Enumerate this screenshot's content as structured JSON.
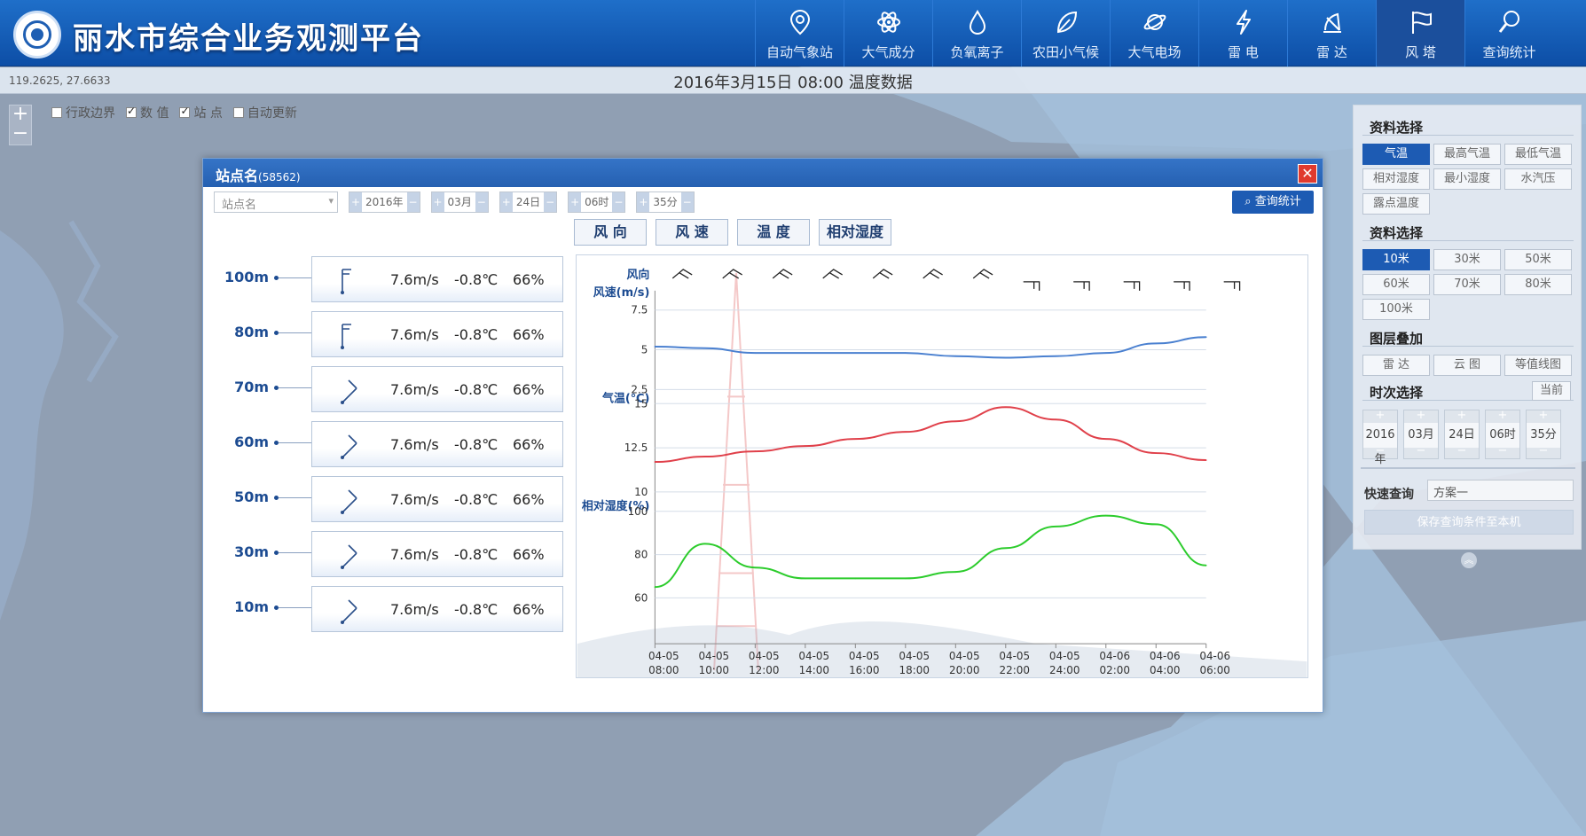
{
  "app": {
    "title": "丽水市综合业务观测平台"
  },
  "nav": [
    {
      "label": "自动气象站",
      "icon": "map-pin-icon"
    },
    {
      "label": "大气成分",
      "icon": "atom-icon"
    },
    {
      "label": "负氧离子",
      "icon": "droplet-icon"
    },
    {
      "label": "农田小气候",
      "icon": "leaf-icon"
    },
    {
      "label": "大气电场",
      "icon": "planet-icon"
    },
    {
      "label": "雷 电",
      "icon": "lightning-icon"
    },
    {
      "label": "雷 达",
      "icon": "radar-icon"
    },
    {
      "label": "风 塔",
      "icon": "wind-tower-icon",
      "active": true
    },
    {
      "label": "查询统计",
      "icon": "search-icon"
    }
  ],
  "subbar": {
    "coords": "119.2625, 27.6633",
    "title": "2016年3月15日 08:00 温度数据"
  },
  "layers": [
    {
      "label": "行政边界",
      "checked": false
    },
    {
      "label": "数 值",
      "checked": true
    },
    {
      "label": "站 点",
      "checked": true
    },
    {
      "label": "自动更新",
      "checked": false
    }
  ],
  "panel": {
    "data_title": "资料选择",
    "data_buttons": [
      "气温",
      "最高气温",
      "最低气温",
      "相对湿度",
      "最小湿度",
      "水汽压",
      "露点温度"
    ],
    "height_title": "资料选择",
    "height_buttons": [
      "10米",
      "30米",
      "50米",
      "60米",
      "70米",
      "80米",
      "100米"
    ],
    "overlay_title": "图层叠加",
    "overlay_buttons": [
      "雷 达",
      "云 图",
      "等值线图"
    ],
    "time_title": "时次选择",
    "time_now": "当前",
    "time_steps": [
      "2016年",
      "03月",
      "24日",
      "06时",
      "35分"
    ],
    "quick_label": "快速查询",
    "quick_value": "方案一",
    "save_label": "保存查询条件至本机"
  },
  "modal": {
    "title": "站点名",
    "station_id": "(58562)",
    "station_placeholder": "站点名",
    "steps": [
      "2016年",
      "03月",
      "24日",
      "06时",
      "35分"
    ],
    "query_label": "查询统计",
    "tabs": [
      "风 向",
      "风 速",
      "温 度",
      "相对湿度"
    ],
    "heights": [
      {
        "h": "100m",
        "speed": "7.6m/s",
        "temp": "-0.8℃",
        "hum": "66%",
        "barb": "flag"
      },
      {
        "h": "80m",
        "speed": "7.6m/s",
        "temp": "-0.8℃",
        "hum": "66%",
        "barb": "flag"
      },
      {
        "h": "70m",
        "speed": "7.6m/s",
        "temp": "-0.8℃",
        "hum": "66%",
        "barb": "diag"
      },
      {
        "h": "60m",
        "speed": "7.6m/s",
        "temp": "-0.8℃",
        "hum": "66%",
        "barb": "diag"
      },
      {
        "h": "50m",
        "speed": "7.6m/s",
        "temp": "-0.8℃",
        "hum": "66%",
        "barb": "diag"
      },
      {
        "h": "30m",
        "speed": "7.6m/s",
        "temp": "-0.8℃",
        "hum": "66%",
        "barb": "diag"
      },
      {
        "h": "10m",
        "speed": "7.6m/s",
        "temp": "-0.8℃",
        "hum": "66%",
        "barb": "diag"
      }
    ]
  },
  "chart_data": {
    "type": "line",
    "x": [
      "04-05 08:00",
      "04-05 10:00",
      "04-05 12:00",
      "04-05 14:00",
      "04-05 16:00",
      "04-05 18:00",
      "04-05 20:00",
      "04-05 22:00",
      "04-05 24:00",
      "04-06 02:00",
      "04-06 04:00",
      "04-06 06:00"
    ],
    "wind_dir_label": "风向",
    "wind_dir": [
      "diag",
      "diag",
      "diag",
      "diag",
      "diag",
      "diag",
      "diag",
      "flat",
      "flat",
      "flat",
      "flat",
      "flat"
    ],
    "panels": [
      {
        "label": "风速(m/s)",
        "ticks": [
          7.5,
          5,
          2.5
        ],
        "ylim": [
          2.5,
          7.5
        ],
        "color": "#4a80d0",
        "values": [
          5.2,
          5.1,
          4.8,
          4.8,
          4.8,
          4.8,
          4.6,
          4.5,
          4.6,
          4.8,
          5.4,
          5.8
        ]
      },
      {
        "label": "气温(℃)",
        "ticks": [
          15,
          12.5,
          10
        ],
        "ylim": [
          10,
          15
        ],
        "color": "#e0404a",
        "values": [
          11.7,
          12.0,
          12.3,
          12.6,
          13.0,
          13.4,
          14.0,
          14.8,
          14.1,
          13.0,
          12.2,
          11.8
        ]
      },
      {
        "label": "相对湿度(%)",
        "ticks": [
          100,
          80,
          60
        ],
        "ylim": [
          60,
          100
        ],
        "color": "#2ccc2c",
        "values": [
          65,
          85,
          74,
          69,
          69,
          69,
          72,
          83,
          93,
          98,
          94,
          75
        ]
      }
    ]
  }
}
